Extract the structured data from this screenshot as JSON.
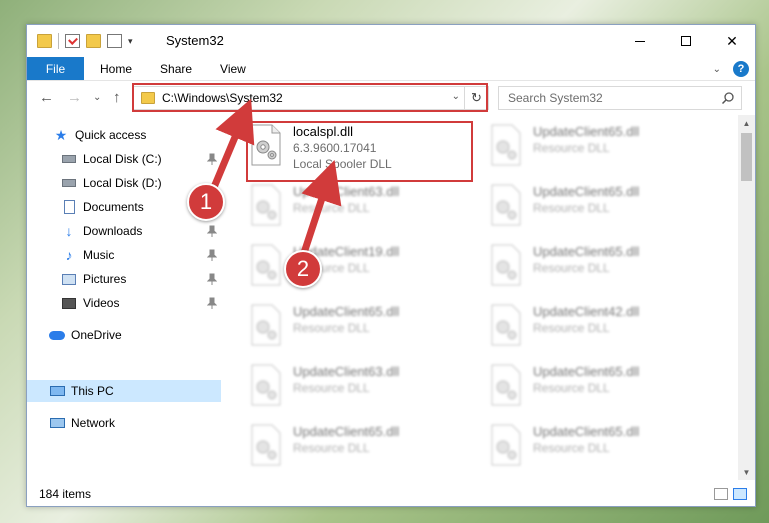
{
  "window": {
    "title": "System32",
    "minimize_glyph": "",
    "maximize_glyph": "",
    "close_glyph": "✕"
  },
  "ribbon": {
    "tabs": [
      {
        "label": "File"
      },
      {
        "label": "Home"
      },
      {
        "label": "Share"
      },
      {
        "label": "View"
      }
    ],
    "help_glyph": "?",
    "expand_glyph": "⌄"
  },
  "navigation": {
    "back_glyph": "←",
    "forward_glyph": "→",
    "recent_glyph": "⌄",
    "up_glyph": "↑",
    "address_path": "C:\\Windows\\System32",
    "address_dropdown_glyph": "⌄",
    "refresh_glyph": "↻",
    "search_placeholder": "Search System32"
  },
  "sidebar": {
    "items": [
      {
        "label": "Quick access",
        "icon": "star-icon",
        "pinned": false
      },
      {
        "label": "Local Disk (C:)",
        "icon": "drive-icon",
        "pinned": true
      },
      {
        "label": "Local Disk (D:)",
        "icon": "drive-icon",
        "pinned": false
      },
      {
        "label": "Documents",
        "icon": "documents-icon",
        "pinned": true
      },
      {
        "label": "Downloads",
        "icon": "downloads-icon",
        "pinned": true
      },
      {
        "label": "Music",
        "icon": "music-icon",
        "pinned": true
      },
      {
        "label": "Pictures",
        "icon": "pictures-icon",
        "pinned": true
      },
      {
        "label": "Videos",
        "icon": "videos-icon",
        "pinned": true
      },
      {
        "label": "OneDrive",
        "icon": "onedrive-icon",
        "pinned": false
      },
      {
        "label": "This PC",
        "icon": "this-pc-icon",
        "pinned": false,
        "selected": true
      },
      {
        "label": "Network",
        "icon": "network-icon",
        "pinned": false
      }
    ]
  },
  "files": {
    "highlighted": {
      "name": "localspl.dll",
      "version": "6.3.9600.17041",
      "description": "Local Spooler DLL"
    },
    "left_column": [
      {
        "name": "UpdateClient63.dll",
        "description": "Resource DLL"
      },
      {
        "name": "UpdateClient19.dll",
        "description": "Resource DLL"
      },
      {
        "name": "UpdateClient65.dll",
        "description": "Resource DLL"
      },
      {
        "name": "UpdateClient63.dll",
        "description": "Resource DLL"
      },
      {
        "name": "UpdateClient65.dll",
        "description": "Resource DLL"
      }
    ],
    "right_column": [
      {
        "name": "UpdateClient65.dll",
        "description": "Resource DLL"
      },
      {
        "name": "UpdateClient65.dll",
        "description": "Resource DLL"
      },
      {
        "name": "UpdateClient65.dll",
        "description": "Resource DLL"
      },
      {
        "name": "UpdateClient42.dll",
        "description": "Resource DLL"
      },
      {
        "name": "UpdateClient65.dll",
        "description": "Resource DLL"
      },
      {
        "name": "UpdateClient65.dll",
        "description": "Resource DLL"
      }
    ]
  },
  "status_bar": {
    "item_count": "184 items"
  },
  "callouts": {
    "step1": "1",
    "step2": "2"
  },
  "colors": {
    "accent": "#1979ca",
    "highlight_red": "#d13b3b",
    "selected_bg": "#cce8ff"
  }
}
